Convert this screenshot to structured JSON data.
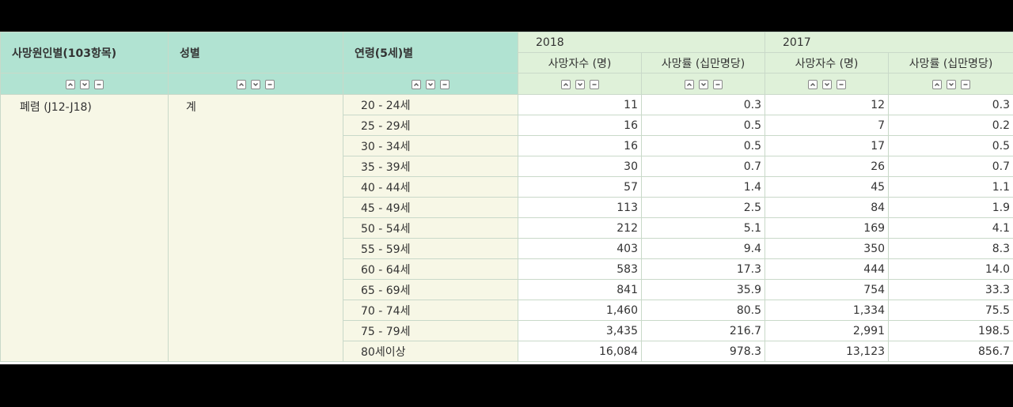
{
  "headers": {
    "cause": "사망원인별(103항목)",
    "sex": "성별",
    "age": "연령(5세)별",
    "years": [
      "2018",
      "2017"
    ],
    "deaths": "사망자수 (명)",
    "rate": "사망률 (십만명당)"
  },
  "row_dims": {
    "cause": "폐렴 (J12-J18)",
    "sex": "계"
  },
  "rows": [
    {
      "age": "20 - 24세",
      "d2018": "11",
      "r2018": "0.3",
      "d2017": "12",
      "r2017": "0.3"
    },
    {
      "age": "25 - 29세",
      "d2018": "16",
      "r2018": "0.5",
      "d2017": "7",
      "r2017": "0.2"
    },
    {
      "age": "30 - 34세",
      "d2018": "16",
      "r2018": "0.5",
      "d2017": "17",
      "r2017": "0.5"
    },
    {
      "age": "35 - 39세",
      "d2018": "30",
      "r2018": "0.7",
      "d2017": "26",
      "r2017": "0.7"
    },
    {
      "age": "40 - 44세",
      "d2018": "57",
      "r2018": "1.4",
      "d2017": "45",
      "r2017": "1.1"
    },
    {
      "age": "45 - 49세",
      "d2018": "113",
      "r2018": "2.5",
      "d2017": "84",
      "r2017": "1.9"
    },
    {
      "age": "50 - 54세",
      "d2018": "212",
      "r2018": "5.1",
      "d2017": "169",
      "r2017": "4.1"
    },
    {
      "age": "55 - 59세",
      "d2018": "403",
      "r2018": "9.4",
      "d2017": "350",
      "r2017": "8.3"
    },
    {
      "age": "60 - 64세",
      "d2018": "583",
      "r2018": "17.3",
      "d2017": "444",
      "r2017": "14.0"
    },
    {
      "age": "65 - 69세",
      "d2018": "841",
      "r2018": "35.9",
      "d2017": "754",
      "r2017": "33.3"
    },
    {
      "age": "70 - 74세",
      "d2018": "1,460",
      "r2018": "80.5",
      "d2017": "1,334",
      "r2017": "75.5"
    },
    {
      "age": "75 - 79세",
      "d2018": "3,435",
      "r2018": "216.7",
      "d2017": "2,991",
      "r2017": "198.5"
    },
    {
      "age": "80세이상",
      "d2018": "16,084",
      "r2018": "978.3",
      "d2017": "13,123",
      "r2017": "856.7"
    }
  ],
  "icons": {
    "sort_asc": "chevron-up-icon",
    "sort_desc": "chevron-down-icon",
    "sort_reset": "minus-icon"
  }
}
